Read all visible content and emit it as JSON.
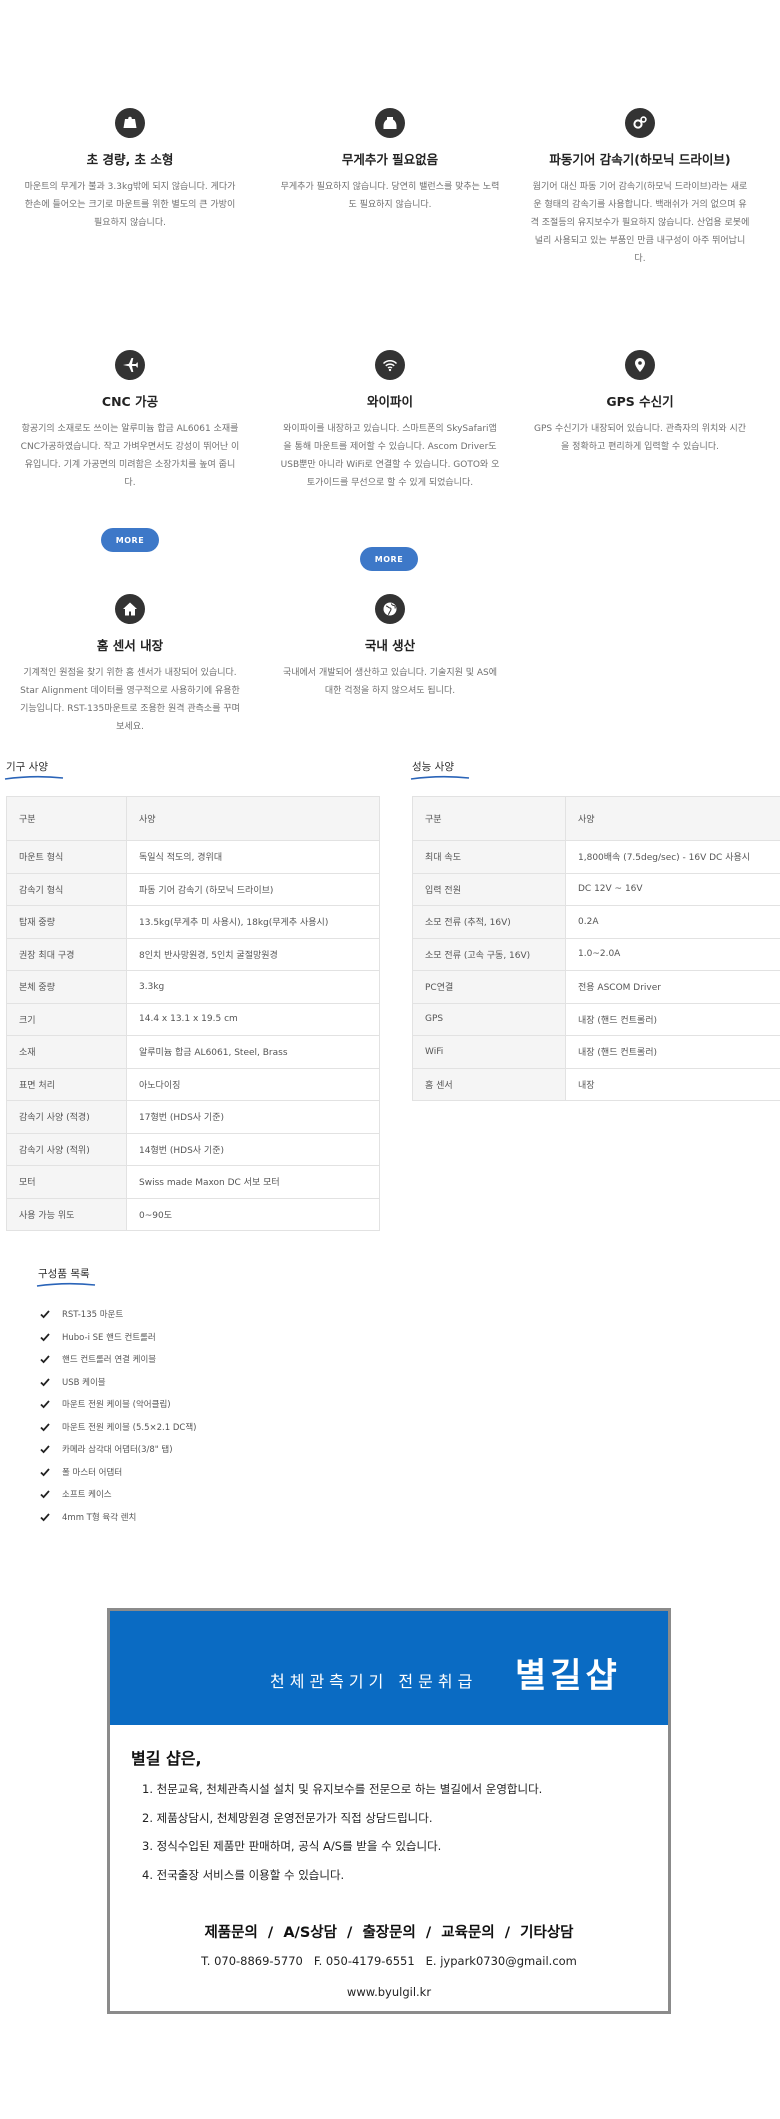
{
  "features": [
    {
      "icon": "scale-icon",
      "title": "초 경량, 초 소형",
      "desc": "마운트의 무게가 불과 3.3kg밖에 되지 않습니다. 게다가 한손에 들어오는 크기로 마운트를 위한 별도의 큰 가방이 필요하지 않습니다."
    },
    {
      "icon": "weight-icon",
      "title": "무게추가 필요없음",
      "desc": "무게추가 필요하지 않습니다. 당연히 밸런스를 맞추는 노력도 필요하지 않습니다."
    },
    {
      "icon": "gears-icon",
      "title": "파동기어 감속기(하모닉 드라이브)",
      "desc": "웜기어 대신 파동 기어 감속기(하모닉 드라이브)라는 새로운 형태의 감속기를 사용합니다. 백래쉬가 거의 없으며 유격 조절등의 유지보수가 필요하지 않습니다. 산업용 로봇에 널리 사용되고 있는 부품인 만큼 내구성이 아주 뛰어납니다."
    },
    {
      "icon": "airplane-icon",
      "title": "CNC 가공",
      "desc": "항공기의 소재로도 쓰이는 알루미늄 합금 AL6061 소재를 CNC가공하였습니다. 작고 가벼우면서도 강성이 뛰어난 이유입니다. 기계 가공면의 미려함은 소장가치를 높여 줍니다."
    },
    {
      "icon": "wifi-icon",
      "title": "와이파이",
      "desc": "와이파이를 내장하고 있습니다. 스마트폰의 SkySafari앱을 통해 마운트를 제어할 수 있습니다. Ascom Driver도 USB뿐만 아니라 WiFi로 연결할 수 있습니다. GOTO와 오토가이드를 무선으로 할 수 있게 되었습니다."
    },
    {
      "icon": "location-pin-icon",
      "title": "GPS 수신기",
      "desc": "GPS 수신기가 내장되어 있습니다. 관측자의 위치와 시간을 정확하고 편리하게 입력할 수 있습니다."
    },
    {
      "icon": "home-icon",
      "title": "홈 센서 내장",
      "desc": "기계적인 원점을 찾기 위한 홈 센서가 내장되어 있습니다. Star Alignment 데이터를 영구적으로 사용하기에 유용한 기능입니다. RST-135마운트로 조용한 원격 관측소를 꾸며보세요."
    },
    {
      "icon": "globe-icon",
      "title": "국내 생산",
      "desc": "국내에서 개발되어 생산하고 있습니다. 기술지원 및 AS에 대한 걱정을 하지 않으셔도 됩니다."
    }
  ],
  "more_label": "MORE",
  "spec_title": "기구 사양",
  "perf_title": "성능 사양",
  "spec_table": {
    "header": [
      "구분",
      "사양"
    ],
    "rows": [
      [
        "마운트 형식",
        "독일식 적도의, 경위대"
      ],
      [
        "감속기 형식",
        "파동 기어 감속기 (하모닉 드라이브)"
      ],
      [
        "탑재 중량",
        "13.5kg(무게추 미 사용시), 18kg(무게추 사용시)"
      ],
      [
        "권장 최대 구경",
        "8인치 반사망원경, 5인치 굴절망원경"
      ],
      [
        "본체 중량",
        "3.3kg"
      ],
      [
        "크기",
        "14.4 x 13.1 x 19.5 cm"
      ],
      [
        "소재",
        "알루미늄 합금 AL6061, Steel, Brass"
      ],
      [
        "표면 처리",
        "아노다이징"
      ],
      [
        "감속기 사양 (적경)",
        "17형번 (HDS사 기준)"
      ],
      [
        "감속기 사양 (적위)",
        "14형번 (HDS사 기준)"
      ],
      [
        "모터",
        "Swiss made Maxon DC 서보 모터"
      ],
      [
        "사용 가능 위도",
        "0~90도"
      ]
    ]
  },
  "perf_table": {
    "header": [
      "구분",
      "사양"
    ],
    "rows": [
      [
        "최대 속도",
        "1,800배속 (7.5deg/sec) - 16V DC 사용시"
      ],
      [
        "입력 전원",
        "DC 12V ~ 16V"
      ],
      [
        "소모 전류 (추적, 16V)",
        "0.2A"
      ],
      [
        "소모 전류 (고속 구동, 16V)",
        "1.0~2.0A"
      ],
      [
        "PC연결",
        "전용 ASCOM Driver"
      ],
      [
        "GPS",
        "내장 (핸드 컨트롤러)"
      ],
      [
        "WiFi",
        "내장 (핸드 컨트롤러)"
      ],
      [
        "홈 센서",
        "내장"
      ]
    ]
  },
  "components_title": "구성품 목록",
  "components": [
    "RST-135 마운트",
    "Hubo-i SE 핸드 컨트롤러",
    "핸드 컨트롤러 연결 케이블",
    "USB 케이블",
    "마운트 전원 케이블 (악어클립)",
    "마운트 전원 케이블 (5.5×2.1 DC잭)",
    "카메라 삼각대 어댑터(3/8\" 탭)",
    "폴 마스터 어댑터",
    "소프트 케이스",
    "4mm T형 육각 렌치"
  ],
  "banner": {
    "tagline": "천체관측기기 전문취급",
    "brand": "별길샵",
    "heading": "별길 샵은,",
    "points": [
      "1. 천문교육, 천체관측시설 설치 및 유지보수를 전문으로 하는 별길에서 운영합니다.",
      "2. 제품상담시, 천체망원경 운영전문가가 직접 상담드립니다.",
      "3. 정식수입된 제품만 판매하며, 공식 A/S를 받을 수 있습니다.",
      "4. 전국출장 서비스를 이용할 수 있습니다."
    ],
    "contact_line": "제품문의  /  A/S상담  /  출장문의  /  교육문의  /  기타상담",
    "phone_line": "T. 070-8869-5770   F. 050-4179-6551   E. jypark0730@gmail.com",
    "website": "www.byulgil.kr"
  },
  "colors": {
    "accent": "#3d78c8",
    "banner_blue": "#0a6bc3",
    "underline": "#2a64b8"
  }
}
